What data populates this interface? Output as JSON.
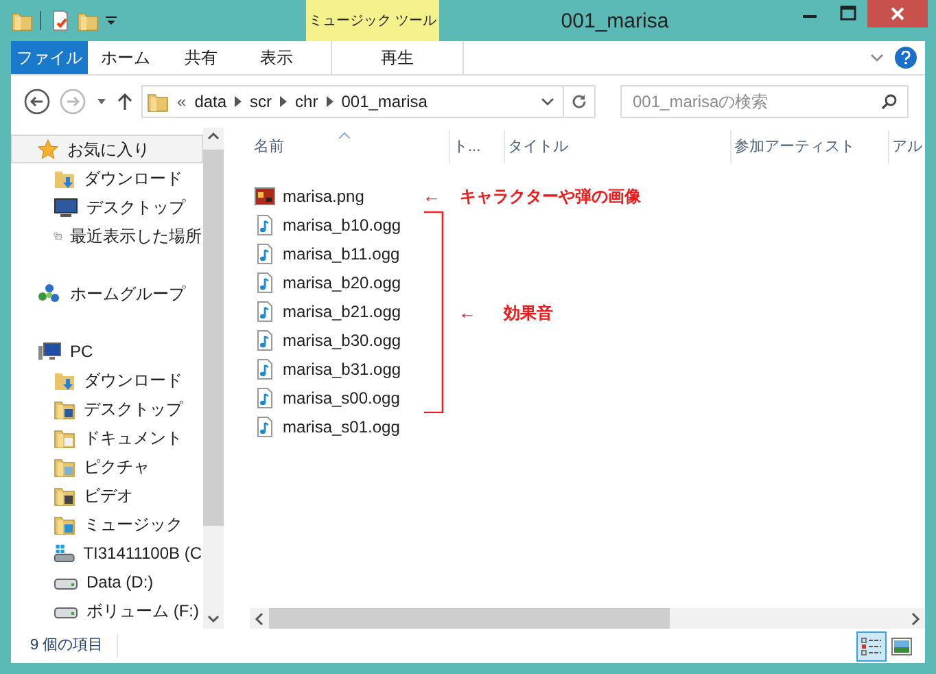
{
  "window": {
    "title": "001_marisa",
    "contextual_tab": "ミュージック ツール"
  },
  "ribbon_tabs": [
    {
      "label": "ファイル",
      "kind": "file"
    },
    {
      "label": "ホーム",
      "kind": "tab"
    },
    {
      "label": "共有",
      "kind": "tab"
    },
    {
      "label": "表示",
      "kind": "tab"
    },
    {
      "label": "再生",
      "kind": "contextual"
    }
  ],
  "address": {
    "overflow": "«",
    "crumbs": [
      "data",
      "scr",
      "chr",
      "001_marisa"
    ]
  },
  "search": {
    "placeholder": "001_marisaの検索"
  },
  "sidebar": {
    "groups": [
      {
        "label": "お気に入り",
        "kind": "star",
        "selected": true,
        "children": [
          {
            "label": "ダウンロード",
            "kind": "download",
            "selected": false
          },
          {
            "label": "デスクトップ",
            "kind": "desktop",
            "selected": false
          },
          {
            "label": "最近表示した場所",
            "kind": "recent",
            "selected": false
          }
        ]
      },
      {
        "label": "ホームグループ",
        "kind": "homegroup",
        "selected": false
      },
      {
        "label": "PC",
        "kind": "pc",
        "selected": false,
        "children": [
          {
            "label": "ダウンロード",
            "kind": "download",
            "selected": false
          },
          {
            "label": "デスクトップ",
            "kind": "folder-desktop",
            "selected": false
          },
          {
            "label": "ドキュメント",
            "kind": "folder-doc",
            "selected": false
          },
          {
            "label": "ピクチャ",
            "kind": "folder-pic",
            "selected": false
          },
          {
            "label": "ビデオ",
            "kind": "folder-video",
            "selected": false
          },
          {
            "label": "ミュージック",
            "kind": "folder-music",
            "selected": false
          },
          {
            "label": "TI31411100B (C",
            "kind": "os-drive",
            "selected": false
          },
          {
            "label": "Data (D:)",
            "kind": "drive",
            "selected": false
          },
          {
            "label": "ボリューム (F:)",
            "kind": "drive",
            "selected": false
          }
        ]
      }
    ]
  },
  "table": {
    "columns": [
      "名前",
      "ト...",
      "タイトル",
      "参加アーティスト",
      "アル"
    ],
    "rows": [
      {
        "name": "marisa.png",
        "kind": "image"
      },
      {
        "name": "marisa_b10.ogg",
        "kind": "audio"
      },
      {
        "name": "marisa_b11.ogg",
        "kind": "audio"
      },
      {
        "name": "marisa_b20.ogg",
        "kind": "audio"
      },
      {
        "name": "marisa_b21.ogg",
        "kind": "audio"
      },
      {
        "name": "marisa_b30.ogg",
        "kind": "audio"
      },
      {
        "name": "marisa_b31.ogg",
        "kind": "audio"
      },
      {
        "name": "marisa_s00.ogg",
        "kind": "audio"
      },
      {
        "name": "marisa_s01.ogg",
        "kind": "audio"
      }
    ]
  },
  "annotations": [
    {
      "arrow": "←",
      "text": "キャラクターや弾の画像",
      "kind": "single"
    },
    {
      "arrow": "←",
      "text": "効果音",
      "kind": "bracket"
    }
  ],
  "status_bar": {
    "text": "9 個の項目"
  },
  "view_buttons": [
    {
      "kind": "details",
      "selected": true
    },
    {
      "kind": "thumbnails",
      "selected": false
    }
  ]
}
